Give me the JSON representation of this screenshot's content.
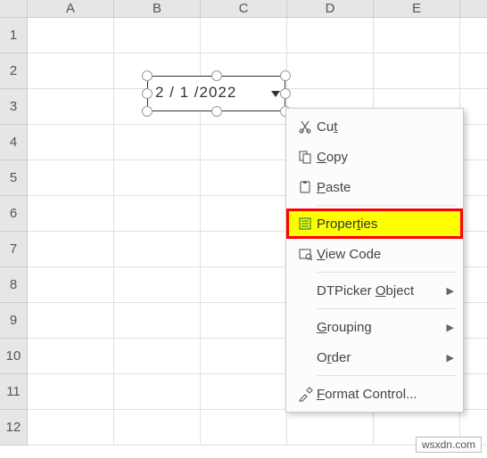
{
  "columns": [
    "A",
    "B",
    "C",
    "D",
    "E"
  ],
  "rows": [
    "1",
    "2",
    "3",
    "4",
    "5",
    "6",
    "7",
    "8",
    "9",
    "10",
    "11",
    "12"
  ],
  "dtpicker": {
    "value": "2 / 1 /2022"
  },
  "menu": {
    "cut": "Cut",
    "copy": "Copy",
    "paste": "Paste",
    "properties": "Properties",
    "view_code": "View Code",
    "dtpicker_object": "DTPicker Object",
    "grouping": "Grouping",
    "order": "Order",
    "format_control": "Format Control..."
  },
  "watermark": "wsxdn.com"
}
